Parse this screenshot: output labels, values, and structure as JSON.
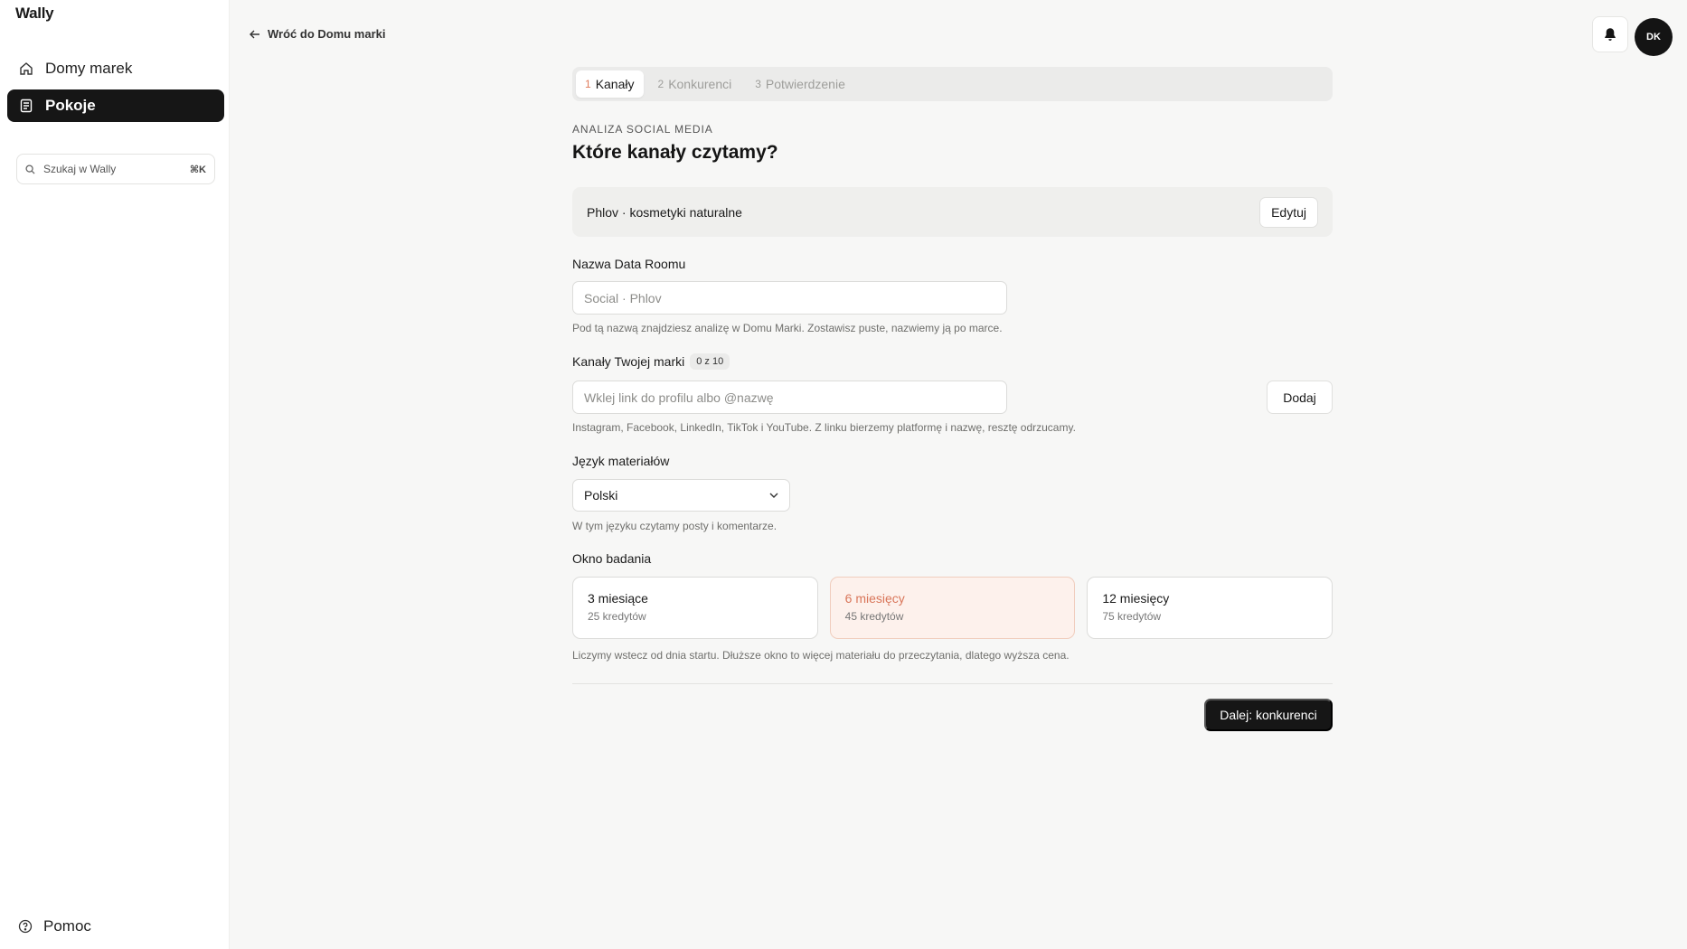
{
  "app": {
    "name": "Wally"
  },
  "sidebar": {
    "items": [
      {
        "label": "Domy marek",
        "icon": "home-icon"
      },
      {
        "label": "Pokoje",
        "icon": "document-icon"
      }
    ],
    "search": {
      "placeholder": "Szukaj w Wally",
      "shortcut": "⌘K"
    },
    "help_label": "Pomoc"
  },
  "header": {
    "back_label": "Wróć do Domu marki",
    "avatar_initials": "DK"
  },
  "stepper": [
    {
      "num": "1",
      "label": "Kanały",
      "active": true
    },
    {
      "num": "2",
      "label": "Konkurenci",
      "active": false
    },
    {
      "num": "3",
      "label": "Potwierdzenie",
      "active": false
    }
  ],
  "page": {
    "eyebrow": "ANALIZA SOCIAL MEDIA",
    "title": "Które kanały czytamy?"
  },
  "brand_card": {
    "text": "Phlov · kosmetyki naturalne",
    "edit_label": "Edytuj"
  },
  "room_name": {
    "label": "Nazwa Data Roomu",
    "placeholder": "Social · Phlov",
    "hint": "Pod tą nazwą znajdziesz analizę w Domu Marki. Zostawisz puste, nazwiemy ją po marce."
  },
  "channels": {
    "label": "Kanały Twojej marki",
    "count": "0 z 10",
    "placeholder": "Wklej link do profilu albo @nazwę",
    "add_label": "Dodaj",
    "hint": "Instagram, Facebook, LinkedIn, TikTok i YouTube. Z linku bierzemy platformę i nazwę, resztę odrzucamy."
  },
  "language": {
    "label": "Język materiałów",
    "value": "Polski",
    "hint": "W tym języku czytamy posty i komentarze."
  },
  "window": {
    "label": "Okno badania",
    "options": [
      {
        "title": "3 miesiące",
        "credits": "25 kredytów",
        "selected": false
      },
      {
        "title": "6 miesięcy",
        "credits": "45 kredytów",
        "selected": true
      },
      {
        "title": "12 miesięcy",
        "credits": "75 kredytów",
        "selected": false
      }
    ],
    "hint": "Liczymy wstecz od dnia startu. Dłuższe okno to więcej materiału do przeczytania, dlatego wyższa cena."
  },
  "next_label": "Dalej: konkurenci",
  "colors": {
    "accent": "#d9765a",
    "accent_bg": "#fdf1ec",
    "dark": "#161616"
  }
}
